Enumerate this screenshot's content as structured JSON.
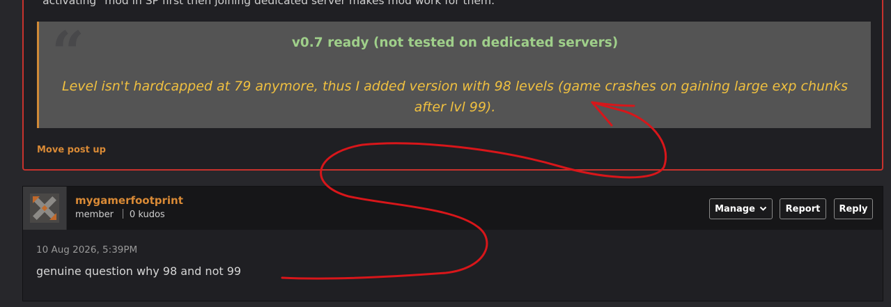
{
  "previous_post": {
    "text_fragment": "\"activating\" mod in SP first then joining dedicated server makes mod work for them.",
    "quote": {
      "title": "v0.7 ready (not tested on dedicated servers)",
      "body": "Level isn't hardcapped at 79 anymore, thus I added version with 98 levels (game crashes on gaining large exp chunks after lvl 99)."
    },
    "move_post_up": "Move post up"
  },
  "comment": {
    "username": "mygamerfootprint",
    "role": "member",
    "kudos": "0 kudos",
    "buttons": {
      "manage": "Manage",
      "report": "Report",
      "reply": "Reply"
    },
    "timestamp": "10 Aug 2026, 5:39PM",
    "text": "genuine question why 98 and not 99"
  },
  "colors": {
    "accent_orange": "#d98a36",
    "highlight_border": "#c8322d",
    "quote_title": "#9fcf8a",
    "quote_body": "#f0c040",
    "annotation_red": "#d8161a"
  },
  "icons": [
    "quote-icon",
    "chevron-down-icon",
    "avatar-icon"
  ]
}
